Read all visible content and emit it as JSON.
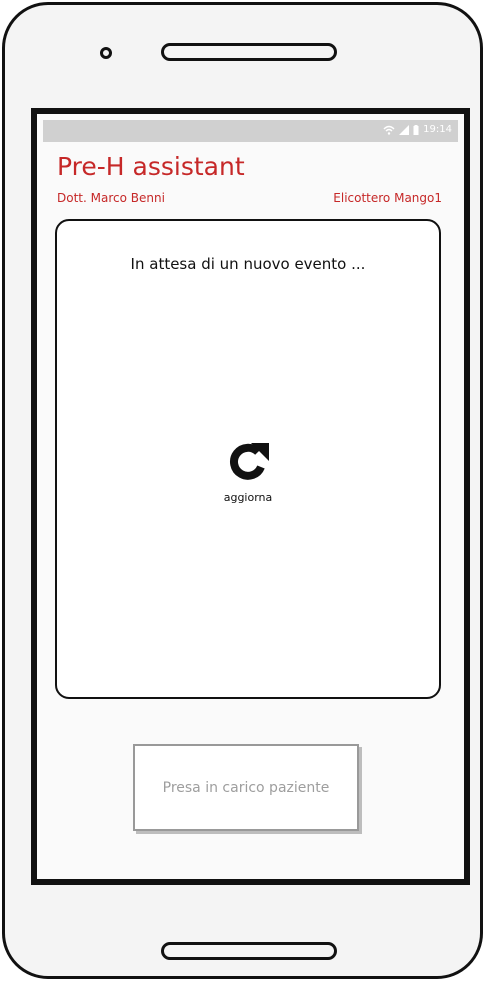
{
  "status_bar": {
    "time": "19:14"
  },
  "header": {
    "title": "Pre-H assistant",
    "doctor": "Dott. Marco Benni",
    "vehicle": "Elicottero Mango1"
  },
  "panel": {
    "message": "In attesa di un nuovo evento ...",
    "refresh_label": "aggiorna"
  },
  "action": {
    "label": "Presa in carico paziente"
  },
  "colors": {
    "accent": "#c62828",
    "disabled_text": "#9e9e9e"
  }
}
